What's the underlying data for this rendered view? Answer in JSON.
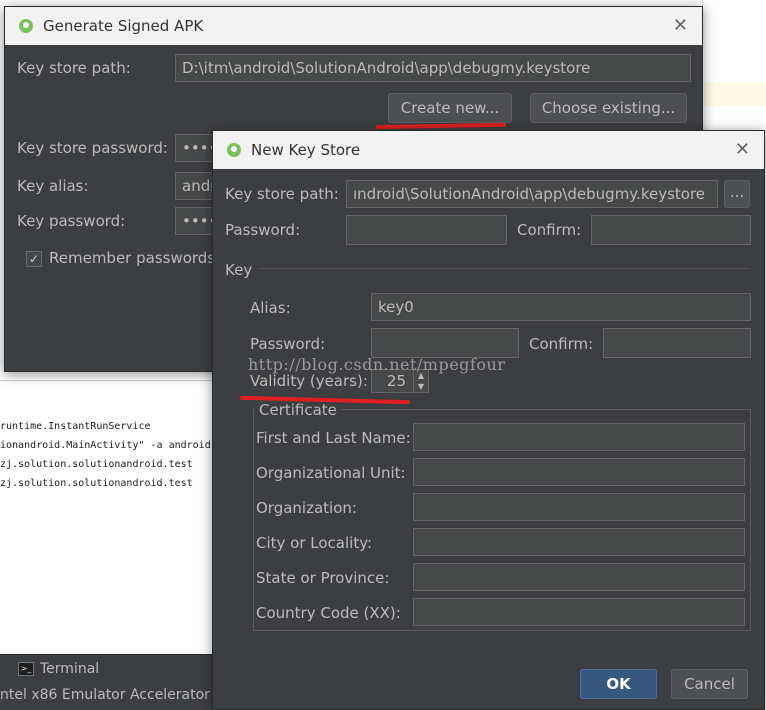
{
  "background": {
    "console_lines": [
      "runtime.InstantRunService",
      "ionandroid.MainActivity\" -a android.",
      "zj.solution.solutionandroid.test",
      "zj.solution.solutionandroid.test"
    ],
    "terminal_tab": "Terminal",
    "terminal_icon": ">_",
    "status_text": "ntel x86 Emulator Accelerator"
  },
  "signed_apk": {
    "title": "Generate Signed APK",
    "close": "✕",
    "key_store_path_label": "Key store path:",
    "key_store_path_value": "D:\\itm\\android\\SolutionAndroid\\app\\debugmy.keystore",
    "create_new_label": "Create new...",
    "choose_existing_label": "Choose existing...",
    "key_store_password_label": "Key store password:",
    "key_store_password_value": "••••",
    "key_alias_label": "Key alias:",
    "key_alias_value": "andr",
    "key_password_label": "Key password:",
    "key_password_value": "••••",
    "remember_passwords_label": "Remember passwords",
    "remember_checked": "✓"
  },
  "new_key_store": {
    "title": "New Key Store",
    "close": "✕",
    "key_store_path_label": "Key store path:",
    "key_store_path_value": "ındroid\\SolutionAndroid\\app\\debugmy.keystore",
    "browse_label": "...",
    "password_label": "Password:",
    "confirm_label": "Confirm:",
    "key_section_label": "Key",
    "alias_label": "Alias:",
    "alias_value": "key0",
    "key_password_label": "Password:",
    "key_confirm_label": "Confirm:",
    "validity_label": "Validity (years):",
    "validity_value": "25",
    "spinner_up": "▲",
    "spinner_down": "▼",
    "certificate_title": "Certificate",
    "first_last_name_label": "First and Last Name:",
    "org_unit_label": "Organizational Unit:",
    "organization_label": "Organization:",
    "city_label": "City or Locality:",
    "state_label": "State or Province:",
    "country_code_label": "Country Code (XX):",
    "ok_label": "OK",
    "cancel_label": "Cancel"
  },
  "watermark": "http://blog.csdn.net/mpegfour",
  "colors": {
    "dialog_bg": "#3c3f41",
    "field_bg": "#45494a",
    "titlebar_bg": "#f2f2f2",
    "accent_blue": "#365880",
    "annotation_red": "#e02020"
  }
}
